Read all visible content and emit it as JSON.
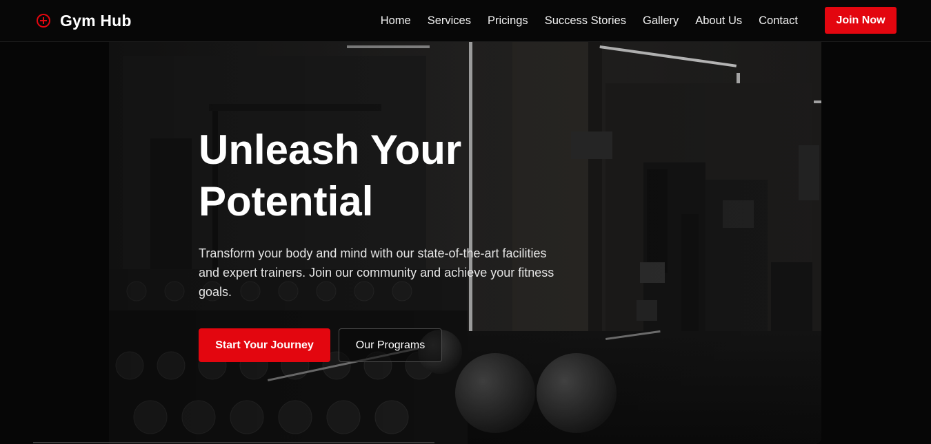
{
  "brand": {
    "name": "Gym Hub",
    "icon": "plus-circle-icon",
    "accent_color": "#e3060f"
  },
  "nav": {
    "links": [
      "Home",
      "Services",
      "Pricings",
      "Success Stories",
      "Gallery",
      "About Us",
      "Contact"
    ],
    "cta_label": "Join Now"
  },
  "hero": {
    "title": "Unleash Your Potential",
    "description": "Transform your body and mind with our state-of-the-art facilities and expert trainers. Join our community and achieve your fitness goals.",
    "primary_button": "Start Your Journey",
    "secondary_button": "Our Programs",
    "background_image": "dark gym interior with equipment"
  },
  "colors": {
    "background": "#060606",
    "button_red": "#e3060f",
    "text": "#ffffff"
  }
}
